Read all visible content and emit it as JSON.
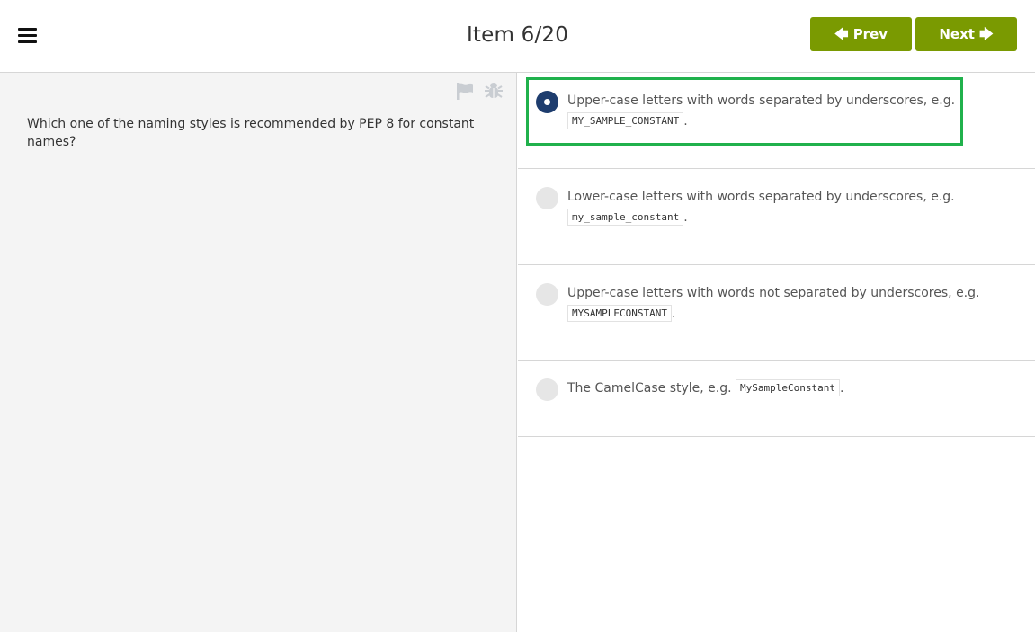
{
  "header": {
    "title": "Item 6/20",
    "prev_label": "Prev",
    "next_label": "Next",
    "accent_color": "#7a9a01"
  },
  "question": {
    "text": "Which one of the naming styles is recommended by PEP 8 for constant names?"
  },
  "options": [
    {
      "selected": true,
      "text_a": "Upper-case letters with words separated by underscores, e.g.",
      "code": "MY_SAMPLE_CONSTANT",
      "text_end": "."
    },
    {
      "selected": false,
      "text_a": "Lower-case letters with words separated by underscores, e.g.",
      "code": "my_sample_constant",
      "text_end": "."
    },
    {
      "selected": false,
      "text_a": "Upper-case letters with words ",
      "emphasis": "not",
      "text_b": " separated by underscores, e.g.",
      "code": "MYSAMPLECONSTANT",
      "text_end": "."
    },
    {
      "selected": false,
      "text_a": "The CamelCase style, e.g. ",
      "code": "MySampleConstant",
      "text_end": "."
    }
  ],
  "icons": {
    "menu": "hamburger-icon",
    "flag": "flag-icon",
    "bug": "bug-icon",
    "prev_arrow": "arrow-left-icon",
    "next_arrow": "arrow-right-icon"
  },
  "highlight_color": "#20b14c",
  "selected_radio_color": "#1e3d6e"
}
